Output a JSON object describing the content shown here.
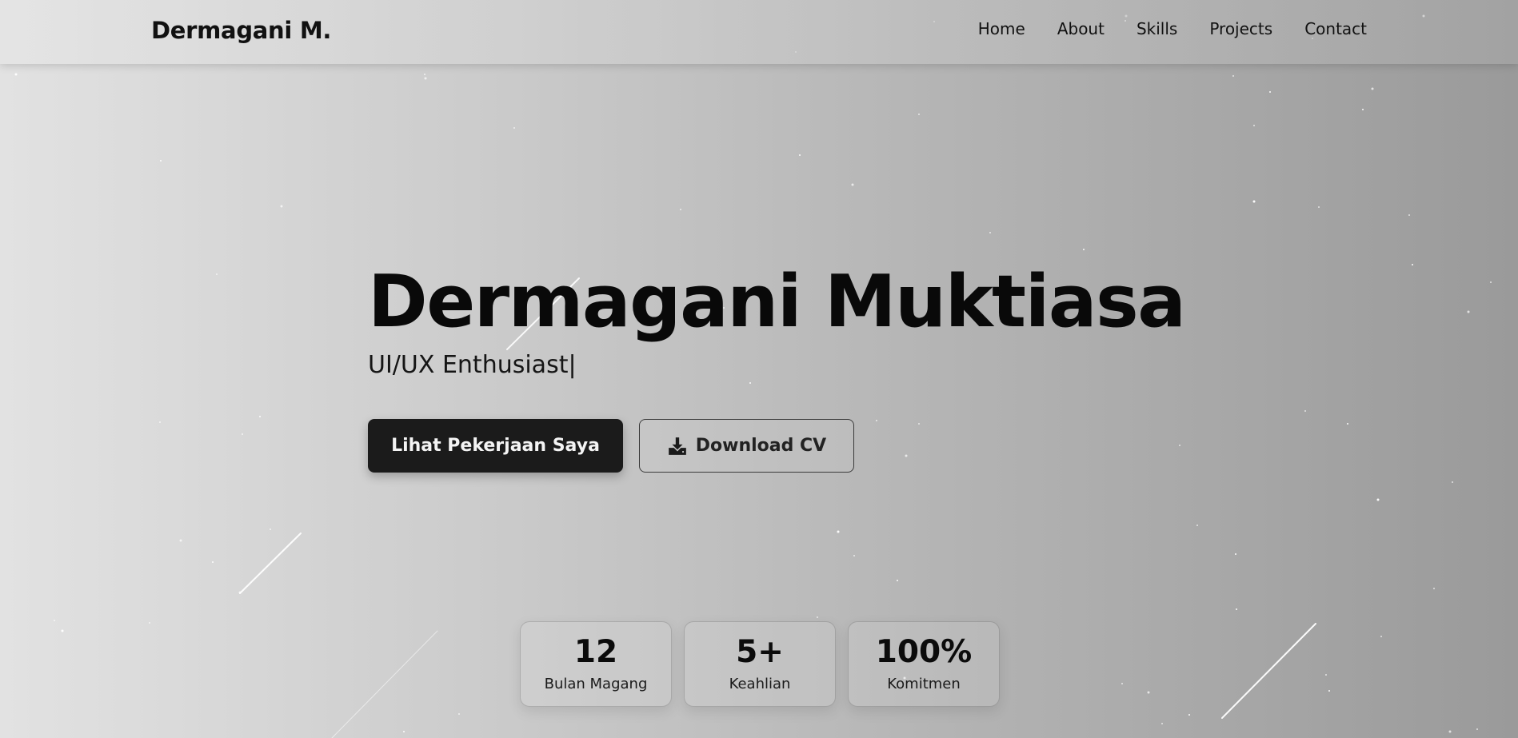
{
  "brand": "Dermagani M.",
  "nav": [
    "Home",
    "About",
    "Skills",
    "Projects",
    "Contact"
  ],
  "hero": {
    "name": "Dermagani Muktiasa",
    "role": "UI/UX Enthusiast",
    "cursor": "|"
  },
  "buttons": {
    "primary": "Lihat Pekerjaan Saya",
    "download": "Download CV",
    "download_icon": "download-icon"
  },
  "stats": [
    {
      "value": "12",
      "label": "Bulan Magang"
    },
    {
      "value": "5+",
      "label": "Keahlian"
    },
    {
      "value": "100%",
      "label": "Komitmen"
    }
  ],
  "colors": {
    "primary_button": "#1b1b1b",
    "text": "#0a0a0a",
    "background_light": "#e2e2e2",
    "background_dark": "#9a9a9a"
  }
}
